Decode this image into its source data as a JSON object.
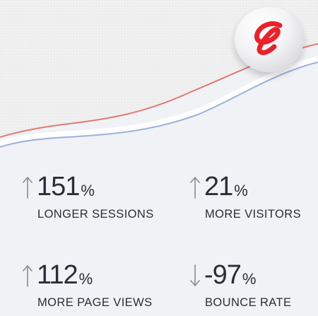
{
  "brand": {
    "logo_icon": "airtel-swirl-icon",
    "accent_color": "#e8232a"
  },
  "stats": [
    {
      "direction": "up",
      "arrow_icon": "arrow-up-icon",
      "value": "151",
      "unit": "%",
      "label": "LONGER SESSIONS"
    },
    {
      "direction": "up",
      "arrow_icon": "arrow-up-icon",
      "value": "21",
      "unit": "%",
      "label": "MORE VISITORS"
    },
    {
      "direction": "up",
      "arrow_icon": "arrow-up-icon",
      "value": "112",
      "unit": "%",
      "label": "MORE PAGE VIEWS"
    },
    {
      "direction": "down",
      "arrow_icon": "arrow-down-icon",
      "value": "-97",
      "unit": "%",
      "label": "BOUNCE RATE"
    }
  ]
}
